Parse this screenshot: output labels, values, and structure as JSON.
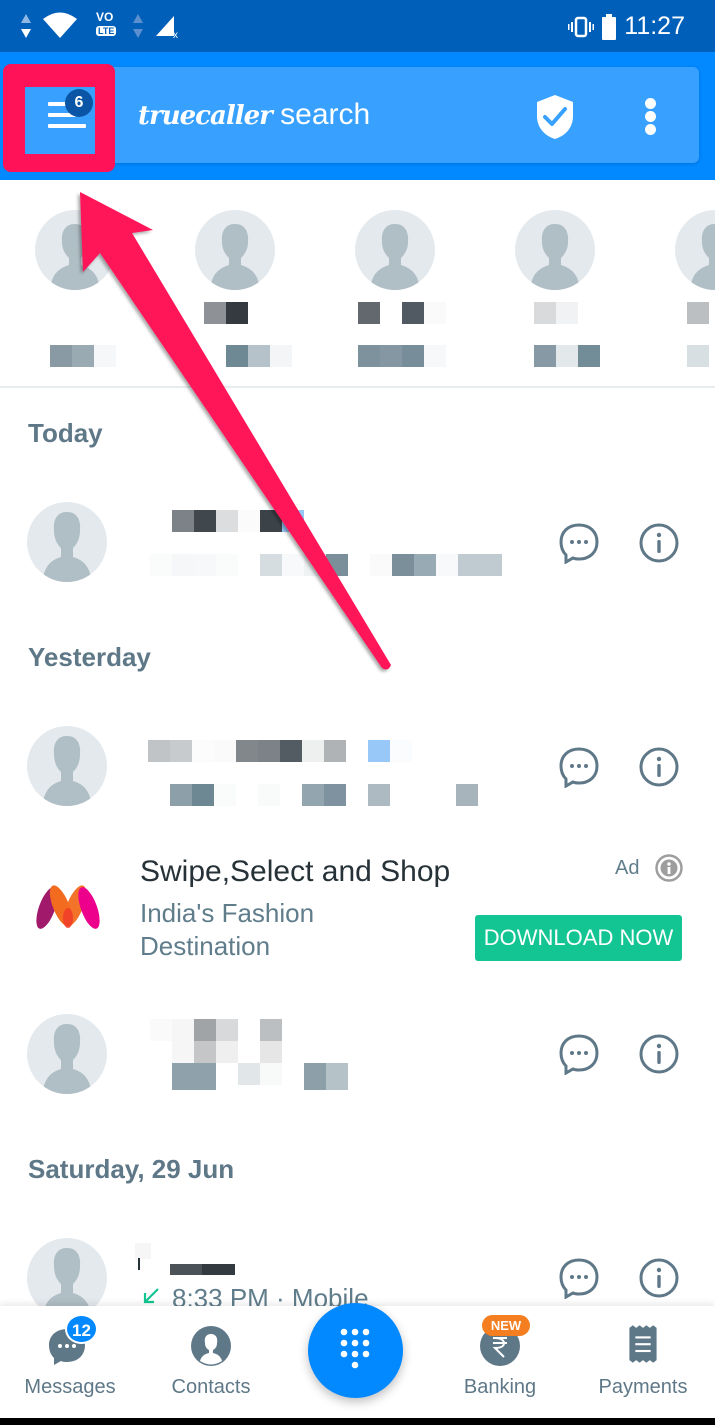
{
  "status_bar": {
    "time": "11:27",
    "icons": [
      "data-arrows-icon",
      "wifi-icon",
      "volte-lte-icon",
      "data-arrows-icon",
      "signal-no-service-icon",
      "vibrate-icon",
      "battery-icon"
    ],
    "volte_label": "VO",
    "lte_label": "LTE"
  },
  "header": {
    "menu_badge": "6",
    "brand_script": "truecaller",
    "brand_suffix": " search",
    "icons": [
      "menu-icon",
      "shield-check-icon",
      "more-vert-icon"
    ]
  },
  "annotation": {
    "highlight_color": "#ff1258",
    "target": "menu-button"
  },
  "frequent_contacts": {
    "count_visible": 5,
    "names_redacted": true
  },
  "call_log": {
    "sections": [
      {
        "title": "Today"
      },
      {
        "title": "Yesterday"
      },
      {
        "title": "Saturday, 29 Jun"
      }
    ],
    "last_item_detail": "8:33 PM · Mobile",
    "call_type_icon": "incoming-call-icon"
  },
  "ad": {
    "title": "Swipe,Select and Shop",
    "subtitle": "India's Fashion Destination",
    "label": "Ad",
    "cta": "DOWNLOAD NOW",
    "brand_icon": "myntra-logo-icon"
  },
  "bottom_nav": {
    "items": [
      {
        "label": "Messages",
        "badge": "12",
        "icon": "message-icon"
      },
      {
        "label": "Contacts",
        "icon": "contact-icon"
      },
      {
        "label": "Banking",
        "badge": "NEW",
        "icon": "rupee-icon"
      },
      {
        "label": "Payments",
        "icon": "receipt-icon"
      }
    ],
    "dialpad_icon": "dialpad-icon"
  },
  "colors": {
    "status_bar": "#005fb8",
    "header": "#0288ff",
    "search_bar": "#38a1ff",
    "accent_green": "#13c592",
    "section_text": "#5f7888",
    "new_badge": "#f57f20"
  }
}
